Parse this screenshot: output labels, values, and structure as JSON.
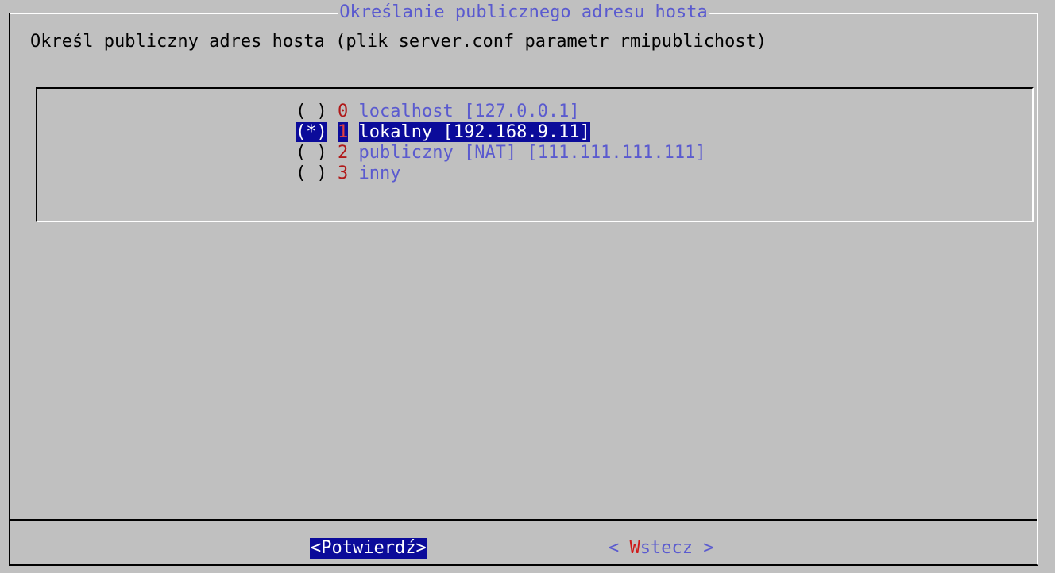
{
  "dialog": {
    "title": "Określanie publicznego adresu hosta",
    "prompt": "Określ publiczny adres hosta (plik server.conf parametr rmipublichost)"
  },
  "options": [
    {
      "mark": "( )",
      "number": "0",
      "label": "localhost [127.0.0.1]",
      "selected": false
    },
    {
      "mark": "(*)",
      "number": "1",
      "label": "lokalny [192.168.9.11]",
      "selected": true
    },
    {
      "mark": "( )",
      "number": "2",
      "label": "publiczny [NAT] [111.111.111.111]",
      "selected": false
    },
    {
      "mark": "( )",
      "number": "3",
      "label": "inny",
      "selected": false
    }
  ],
  "buttons": {
    "confirm": "<Potwierdź>",
    "back_prefix": "< ",
    "back_hotkey": "W",
    "back_rest": "stecz >"
  },
  "colors": {
    "background": "#c0c0c0",
    "title": "#5a5acf",
    "selection": "#0b0b9a",
    "hotkey": "#d01818"
  }
}
